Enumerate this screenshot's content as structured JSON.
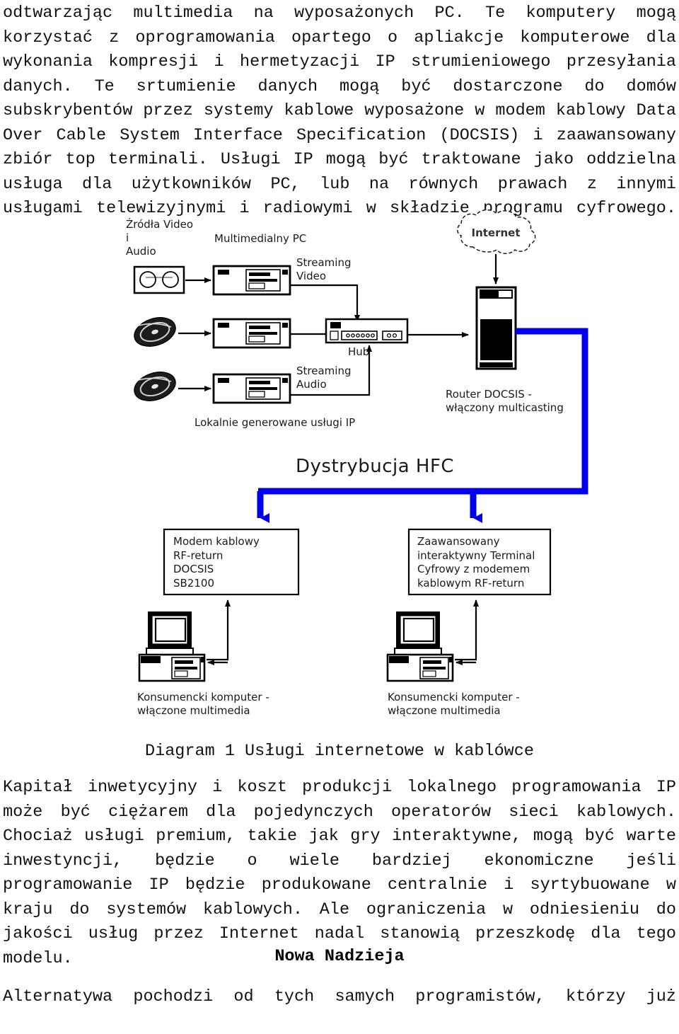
{
  "document": {
    "body_text_1": "odtwarzając multimedia na wyposażonych PC. Te komputery mogą korzystać z oprogramowania opartego o apliakcje komputerowe dla wykonania kompresji i hermetyzacji IP strumieniowego przesyłania danych. Te srtumienie danych mogą być dostarczone do domów subskrybentów przez systemy kablowe wyposażone w modem kablowy Data Over Cable System Interface Specification (DOCSIS) i zaawansowany zbiór  top terminali. Usługi IP mogą być traktowane jako oddzielna usługa dla użytkowników PC, lub na równych prawach z innymi usługami telewizyjnymi i radiowymi w składzie programu cyfrowego.",
    "figure_caption": "Diagram 1 Usługi internetowe w kablówce",
    "body_text_2": "Kapitał inwetycyjny i koszt produkcji lokalnego programowania IP może być ciężarem dla pojedynczych operatorów sieci kablowych. Chociaż usługi premium, takie jak gry interaktywne, mogą być warte inwestyncji, będzie o wiele bardziej ekonomiczne jeśli programowanie IP będzie produkowane centralnie i syrtybuowane w kraju do systemów kablowych. Ale ograniczenia w odniesieniu do jakości usług przez Internet nadal stanowią przeszkodę dla tego modelu.",
    "section_heading": "Nowa Nadzieja",
    "body_text_3": "Alternatywa pochodzi od tych samych programistów, którzy już"
  },
  "diagram": {
    "labels": {
      "video_audio_sources": "Źródła Video\ni\nAudio",
      "multimedia_pc": "Multimedialny PC",
      "streaming_video": "Streaming\nVideo",
      "streaming_audio": "Streaming\nAudio",
      "hub": "Hub",
      "local_ip_services": "Lokalnie generowane usługi IP",
      "internet": "Internet",
      "router_docsis": "Router DOCSIS -\nwłączony multicasting",
      "hfc_distribution": "Dystrybucja HFC",
      "cable_modem_box": "Modem kablowy\nRF-return\nDOCSIS\nSB2100",
      "advanced_terminal_box": "Zaawansowany\ninteraktywny Terminal\nCyfrowy z modemem\nkablowym RF-return",
      "consumer_pc_left": "Konsumencki komputer -\nwłączone multimedia",
      "consumer_pc_right": "Konsumencki komputer -\nwłączone multimedia"
    },
    "icons": {
      "video_source": "video-audio-source-icon",
      "disc_1": "optical-disc-icon",
      "disc_2": "optical-disc-icon",
      "pc_1": "desktop-computer-icon",
      "pc_2": "desktop-computer-icon",
      "pc_3": "desktop-computer-icon",
      "hub": "network-hub-icon",
      "cloud": "internet-cloud-icon",
      "router": "server-tower-icon",
      "consumer_pc_left": "desktop-computer-icon",
      "consumer_pc_right": "desktop-computer-icon"
    },
    "colors": {
      "hfc_link": "#0000ee",
      "line": "#000000",
      "text": "#1a1a1a"
    }
  }
}
